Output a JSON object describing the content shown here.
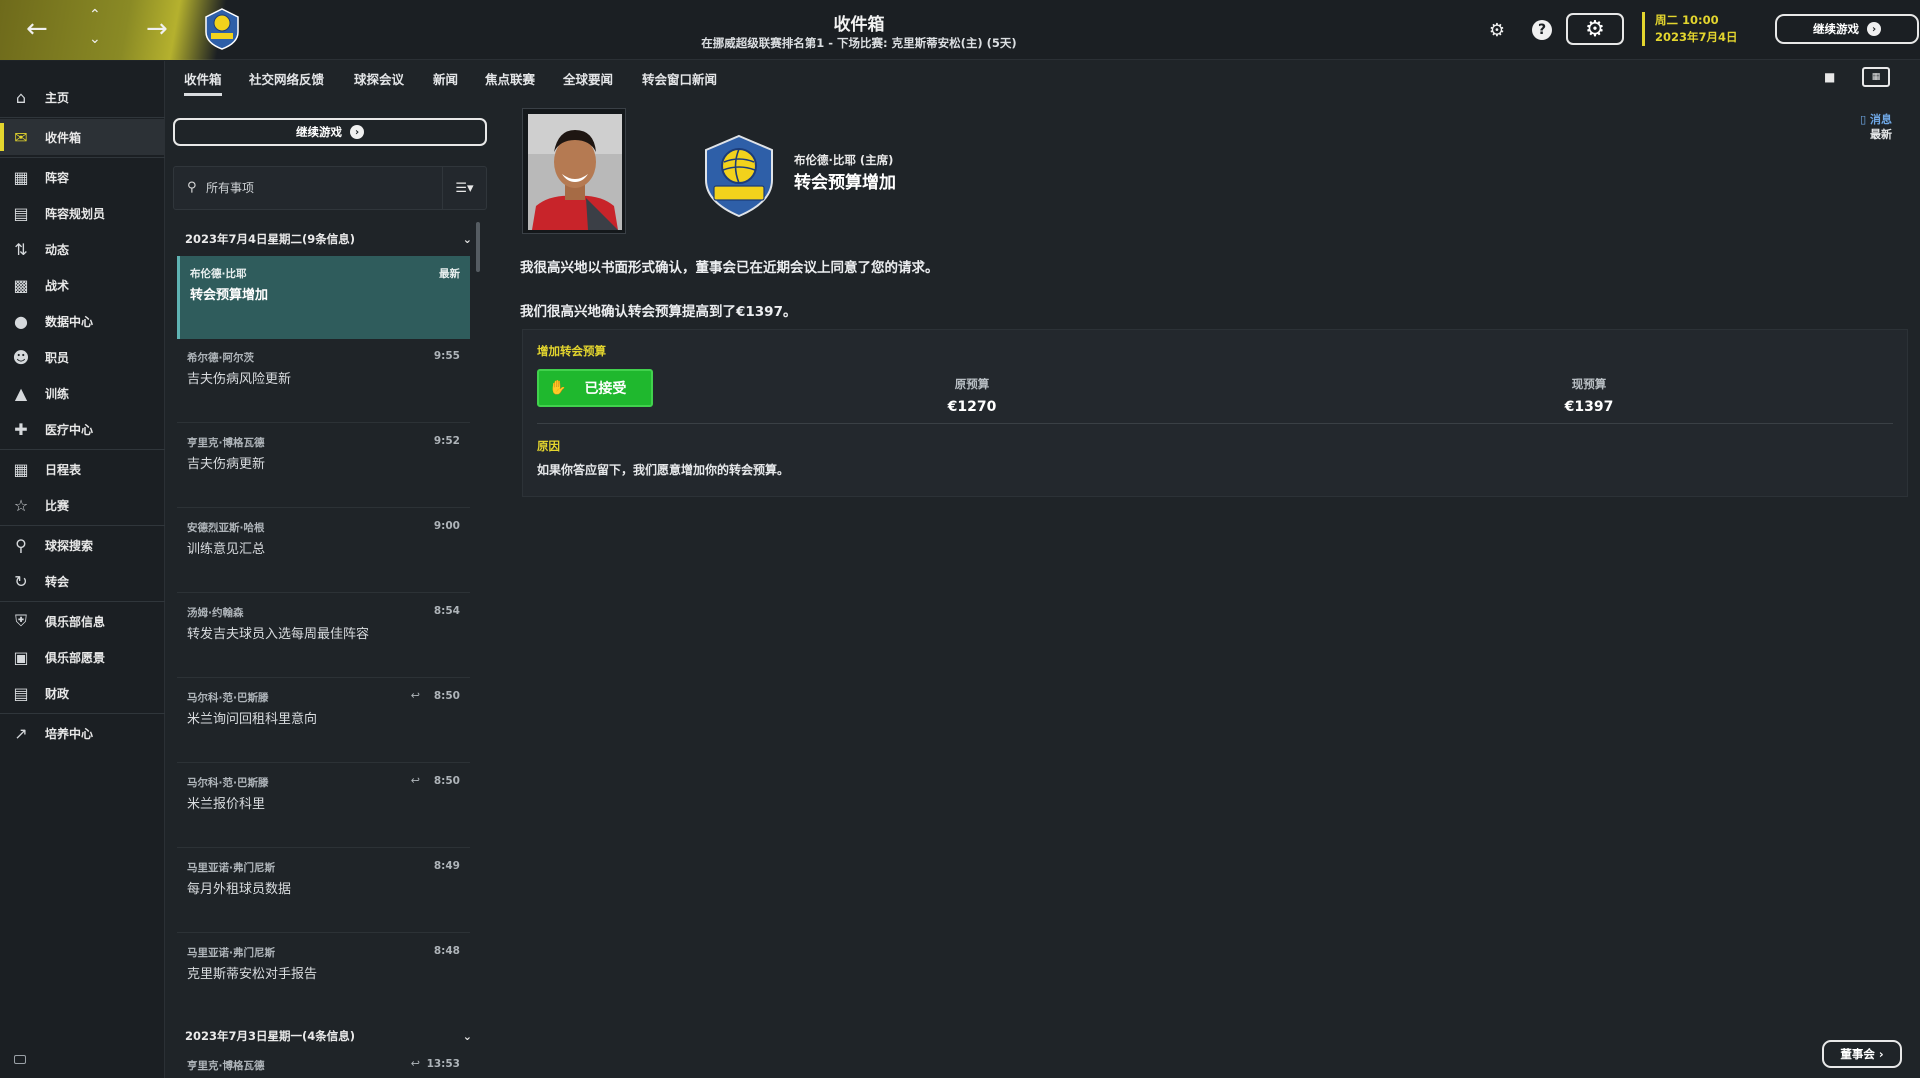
{
  "header": {
    "title": "收件箱",
    "subtitle": "在挪威超级联赛排名第1 - 下场比赛: 克里斯蒂安松(主) (5天)",
    "date_line1": "周二 10:00",
    "date_line2": "2023年7月4日",
    "continue_label": "继续游戏",
    "nav_back_icon": "arrow-left-icon",
    "nav_forward_icon": "arrow-right-icon",
    "colors": {
      "accent": "#e3d52e",
      "gold": "#9a9627"
    }
  },
  "sidebar": {
    "items": [
      {
        "label": "主页",
        "icon": "home-icon"
      },
      {
        "label": "收件箱",
        "icon": "inbox-icon"
      },
      {
        "label": "阵容",
        "icon": "shirt-icon"
      },
      {
        "label": "阵容规划员",
        "icon": "clipboard-icon"
      },
      {
        "label": "动态",
        "icon": "dynamics-icon"
      },
      {
        "label": "战术",
        "icon": "tactics-icon"
      },
      {
        "label": "数据中心",
        "icon": "data-icon"
      },
      {
        "label": "职员",
        "icon": "staff-icon"
      },
      {
        "label": "训练",
        "icon": "training-icon"
      },
      {
        "label": "医疗中心",
        "icon": "medical-icon"
      },
      {
        "label": "日程表",
        "icon": "calendar-icon"
      },
      {
        "label": "比赛",
        "icon": "trophy-icon"
      },
      {
        "label": "球探搜索",
        "icon": "search-icon"
      },
      {
        "label": "转会",
        "icon": "transfer-icon"
      },
      {
        "label": "俱乐部信息",
        "icon": "shield-icon"
      },
      {
        "label": "俱乐部愿景",
        "icon": "briefcase-icon"
      },
      {
        "label": "财政",
        "icon": "money-icon"
      },
      {
        "label": "培养中心",
        "icon": "growth-icon"
      }
    ]
  },
  "tabs": [
    "收件箱",
    "社交网络反馈",
    "球探会议",
    "新闻",
    "焦点联赛",
    "全球要闻",
    "转会窗口新闻"
  ],
  "inbox": {
    "continue_label": "继续游戏",
    "search_placeholder": "所有事项",
    "groups": [
      {
        "header": "2023年7月4日星期二(9条信息)"
      },
      {
        "header": "2023年7月3日星期一(4条信息)"
      }
    ],
    "messages": [
      {
        "sender": "布伦德·比耶",
        "time": "最新",
        "subject": "转会预算增加"
      },
      {
        "sender": "希尔德·阿尔茨",
        "time": "9:55",
        "subject": "吉夫伤病风险更新"
      },
      {
        "sender": "亨里克·博格瓦德",
        "time": "9:52",
        "subject": "吉夫伤病更新"
      },
      {
        "sender": "安德烈亚斯·哈根",
        "time": "9:00",
        "subject": "训练意见汇总"
      },
      {
        "sender": "汤姆·约翰森",
        "time": "8:54",
        "subject": "转发吉夫球员入选每周最佳阵容"
      },
      {
        "sender": "马尔科·范·巴斯滕",
        "time": "8:50",
        "subject": "米兰询问回租科里意向"
      },
      {
        "sender": "马尔科·范·巴斯滕",
        "time": "8:50",
        "subject": "米兰报价科里"
      },
      {
        "sender": "马里亚诺·弗门尼斯",
        "time": "8:49",
        "subject": "每月外租球员数据"
      },
      {
        "sender": "马里亚诺·弗门尼斯",
        "time": "8:48",
        "subject": "克里斯蒂安松对手报告"
      },
      {
        "sender": "亨里克·博格瓦德",
        "time": "13:53",
        "subject": ""
      }
    ]
  },
  "detail": {
    "sender": "布伦德·比耶 (主席)",
    "subject": "转会预算增加",
    "link_label": "消息",
    "link_sub": "最新",
    "paragraph1": "我很高兴地以书面形式确认，董事会已在近期会议上同意了您的请求。",
    "paragraph2": "我们很高兴地确认转会预算提高到了€1397。",
    "card": {
      "title": "增加转会预算",
      "accepted_label": "已接受",
      "old_label": "原预算",
      "old_value": "€1270",
      "new_label": "现预算",
      "new_value": "€1397",
      "reason_label": "原因",
      "reason_text": "如果你答应留下，我们愿意增加你的转会预算。"
    }
  },
  "footer": {
    "board_label": "董事会"
  }
}
